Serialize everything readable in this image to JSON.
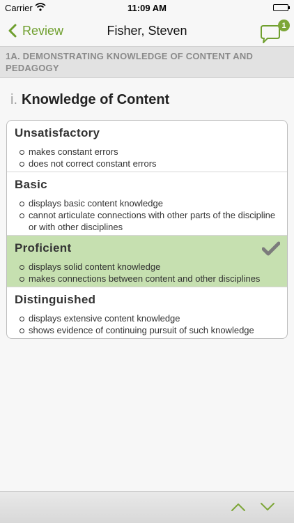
{
  "status_bar": {
    "carrier": "Carrier",
    "time": "11:09 AM"
  },
  "nav": {
    "back_label": "Review",
    "title": "Fisher, Steven",
    "comment_count": "1"
  },
  "section": {
    "code": "1A.",
    "title": "DEMONSTRATING KNOWLEDGE OF CONTENT AND PEDAGOGY"
  },
  "criterion": {
    "number": "i.",
    "title": "Knowledge of Content"
  },
  "levels": [
    {
      "title": "Unsatisfactory",
      "bullets": [
        "makes constant errors",
        "does not correct constant errors"
      ]
    },
    {
      "title": "Basic",
      "bullets": [
        "displays basic content knowledge",
        "cannot articulate connections with other parts of the discipline or with other disciplines"
      ]
    },
    {
      "title": "Proficient",
      "bullets": [
        "displays solid content knowledge",
        "makes connections between content and other disciplines"
      ],
      "selected": true
    },
    {
      "title": "Distinguished",
      "bullets": [
        "displays extensive content knowledge",
        "shows evidence of continuing pursuit of such knowledge"
      ]
    }
  ],
  "colors": {
    "accent": "#6f9f2e",
    "selected_bg": "#c6e0b0",
    "badge": "#7da638"
  },
  "icons": {
    "back": "chevron-left-icon",
    "comment": "speech-bubble-icon",
    "selected": "checkmark-icon",
    "up": "chevron-up-icon",
    "down": "chevron-down-icon"
  }
}
